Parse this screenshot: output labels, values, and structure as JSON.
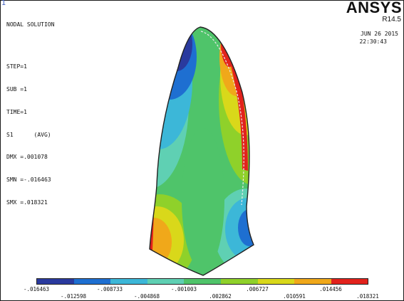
{
  "window": {
    "number": "1"
  },
  "info": {
    "title": "NODAL SOLUTION",
    "step": "STEP=1",
    "sub": "SUB =1",
    "time": "TIME=1",
    "result": "S1      (AVG)",
    "dmx": "DMX =.001078",
    "smn": "SMN =-.016463",
    "smx": "SMX =.018321"
  },
  "header": {
    "brand": "ANSYS",
    "release": "R14.5",
    "date": "JUN 26 2015",
    "clock": "22:30:43"
  },
  "contour_colors": {
    "band_1": "#2a3a9e",
    "band_2": "#1e6fd1",
    "band_3": "#3cb7d8",
    "band_4": "#5fd0b3",
    "band_5": "#4fc46a",
    "band_6": "#8fd12a",
    "band_7": "#d9d81a",
    "band_8": "#f0a81a",
    "band_9": "#e2221c"
  },
  "legend": {
    "top_labels": [
      "-.016463",
      "-.008733",
      "-.001003",
      ".006727",
      ".014456"
    ],
    "bottom_labels": [
      "-.012598",
      "-.004868",
      ".002862",
      ".010591",
      ".018321"
    ]
  }
}
